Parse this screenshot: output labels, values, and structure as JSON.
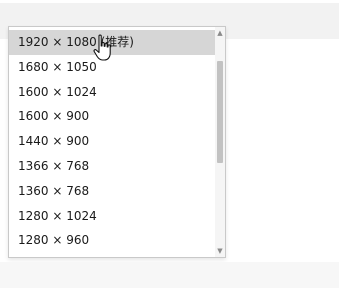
{
  "dropdown": {
    "options": [
      {
        "label": "1920 × 1080 (推荐)",
        "selected": true
      },
      {
        "label": "1680 × 1050",
        "selected": false
      },
      {
        "label": "1600 × 1024",
        "selected": false
      },
      {
        "label": "1600 × 900",
        "selected": false
      },
      {
        "label": "1440 × 900",
        "selected": false
      },
      {
        "label": "1366 × 768",
        "selected": false
      },
      {
        "label": "1360 × 768",
        "selected": false
      },
      {
        "label": "1280 × 1024",
        "selected": false
      },
      {
        "label": "1280 × 960",
        "selected": false
      }
    ],
    "scrollbar": {
      "up_arrow": "▲",
      "down_arrow": "▼",
      "position": 0.0
    }
  },
  "colors": {
    "selected_background": "#d6d6d6",
    "border": "#c9c9c9",
    "thumb": "#c2c2c2"
  },
  "icons": {
    "cursor": "hand-pointer-icon"
  }
}
